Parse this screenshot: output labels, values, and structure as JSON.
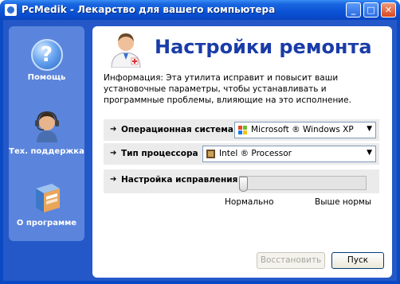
{
  "window": {
    "title": "PcMedik - Лекарство для вашего компьютера",
    "min": "_",
    "max": "□",
    "close": "✕"
  },
  "sidebar": {
    "items": [
      {
        "label": "Помощь",
        "icon": "help-icon",
        "glyph": "?"
      },
      {
        "label": "Тех. поддержка",
        "icon": "headset-support-icon"
      },
      {
        "label": "О программе",
        "icon": "about-box-icon"
      }
    ]
  },
  "main": {
    "heading": "Настройки ремонта",
    "info": "Информация: Эта утилита исправит и повысит ваши установочные параметры, чтобы устанавливать и программные проблемы, влияющие на это исполнение.",
    "arrow": "➔",
    "os": {
      "label": "Операционная система",
      "value": "Microsoft ® Windows XP",
      "icon": "windows-flag-icon"
    },
    "cpu": {
      "label": "Тип процессора",
      "value": "Intel ® Processor",
      "icon": "processor-chip-icon"
    },
    "fix": {
      "label": "Настройка исправления",
      "level": 0,
      "min_label": "Нормально",
      "max_label": "Выше нормы"
    },
    "buttons": {
      "restore": "Восстановить",
      "start": "Пуск"
    }
  },
  "colors": {
    "frame": "#0a49c4",
    "sidebar": "#5b85dc",
    "heading": "#1a3ca8"
  }
}
